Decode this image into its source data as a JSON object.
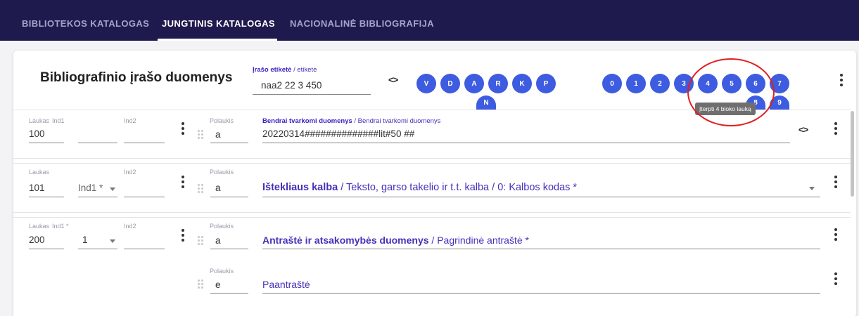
{
  "nav": {
    "tabs": [
      {
        "label": "BIBLIOTEKOS KATALOGAS"
      },
      {
        "label": "JUNGTINIS KATALOGAS"
      },
      {
        "label": "NACIONALINĖ BIBLIOGRAFIJA"
      }
    ],
    "active_tab": "JUNGTINIS KATALOGAS"
  },
  "header": {
    "title": "Bibliografinio įrašo duomenys",
    "label_bold": "Įrašo etiketė",
    "label_rest": " / etiketė",
    "label_value": "naa2 22   3 450",
    "toggle_glyph": "<>",
    "blocks_letters": [
      "V",
      "D",
      "A",
      "R",
      "K",
      "P",
      "N"
    ],
    "blocks_numbers": [
      "0",
      "1",
      "2",
      "3",
      "4",
      "5",
      "6",
      "7",
      "8",
      "9"
    ]
  },
  "tooltip": "Įterpti 4 bloko lauką",
  "rows": [
    {
      "laukas_label": "Laukas",
      "laukas": "100",
      "ind1_label": "Ind1",
      "ind1": "",
      "ind2_label": "Ind2",
      "poslaukis_label": "Polaukis",
      "poslaukis": "a",
      "desc_bold": "Bendrai tvarkomi duomenys",
      "desc_rest": " / Bendrai tvarkomi duomenys",
      "value": "20220314##############lit#50     ##"
    },
    {
      "laukas_label": "Laukas",
      "laukas": "101",
      "ind1_label": "",
      "ind1": "Ind1 *",
      "ind2_label": "Ind2",
      "poslaukis_label": "Polaukis",
      "poslaukis": "a",
      "field_bold": "Ištekliaus kalba",
      "field_rest": " / Teksto, garso takelio ir t.t. kalba / 0: Kalbos kodas *"
    },
    {
      "laukas_label": "Laukas",
      "laukas": "200",
      "ind1_label": "Ind1 *",
      "ind1": "1",
      "ind2_label": "Ind2",
      "subfields": [
        {
          "poslaukis_label": "Polaukis",
          "poslaukis": "a",
          "field_bold": "Antraštė ir atsakomybės duomenys",
          "field_rest": " / Pagrindinė antraštė *"
        },
        {
          "poslaukis_label": "Polaukis",
          "poslaukis": "e",
          "field_bold": "",
          "field_rest": "Paantraštė"
        }
      ]
    }
  ]
}
